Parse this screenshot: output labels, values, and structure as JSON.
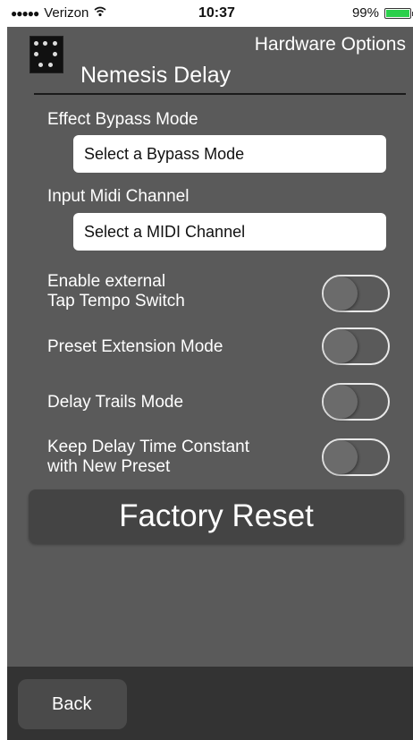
{
  "status_bar": {
    "carrier": "Verizon",
    "time": "10:37",
    "battery": "99%",
    "battery_level": 0.99
  },
  "header": {
    "screen_title": "Hardware Options",
    "device_name": "Nemesis Delay"
  },
  "settings": {
    "bypass_label": "Effect Bypass Mode",
    "bypass_value": "Select a Bypass Mode",
    "midi_label": "Input Midi Channel",
    "midi_value": "Select a MIDI Channel",
    "tap_tempo_line1": "Enable external",
    "tap_tempo_line2": "Tap Tempo Switch",
    "preset_extension_label": "Preset Extension Mode",
    "delay_trails_label": "Delay Trails Mode",
    "keep_delay_line1": "Keep Delay Time Constant",
    "keep_delay_line2": "with New Preset"
  },
  "toggles": {
    "tap_tempo": false,
    "preset_extension": false,
    "delay_trails": false,
    "keep_delay_time": false
  },
  "actions": {
    "factory_reset": "Factory Reset",
    "back": "Back"
  },
  "colors": {
    "background": "#5a5a5a",
    "battery_fill": "#2bd04b",
    "button_dark": "#444444",
    "bottom_bar": "#333333"
  }
}
